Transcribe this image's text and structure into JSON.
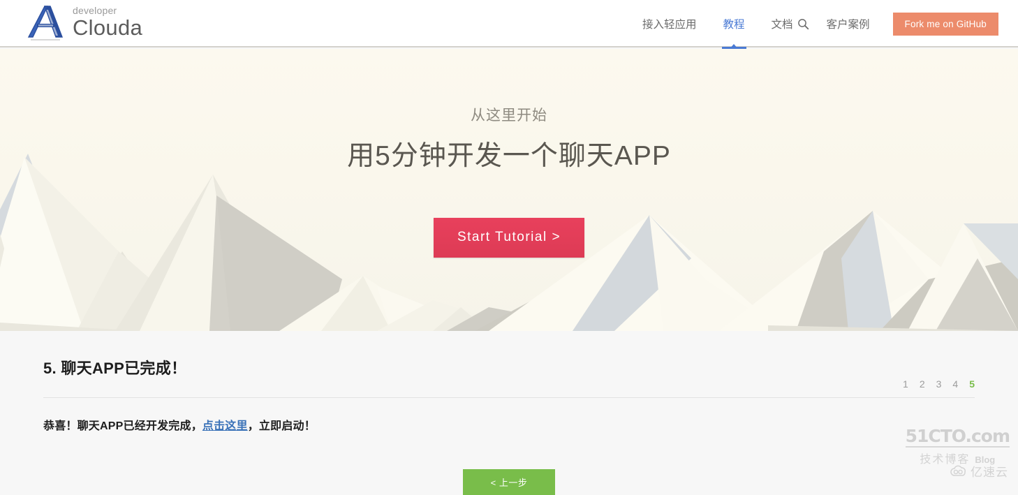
{
  "brand": {
    "sub_label": "developer",
    "name": "Clouda",
    "logo_icon": "clouda-a-logo-icon",
    "logo_color": "#2b4f9e"
  },
  "nav": {
    "items": [
      {
        "label": "接入轻应用",
        "active": false
      },
      {
        "label": "教程",
        "active": true
      },
      {
        "label": "文档",
        "active": false
      },
      {
        "label": "客户案例",
        "active": false
      }
    ],
    "search_icon": "search-icon",
    "github_button": "Fork me on GitHub",
    "active_color": "#4a7ad4",
    "github_color": "#ec8b6b"
  },
  "hero": {
    "subtitle": "从这里开始",
    "title": "用5分钟开发一个聊天APP",
    "cta_label": "Start Tutorial >",
    "cta_color": "#e03b57",
    "background": "low-poly-mountains",
    "sky_color": "#faf7ec"
  },
  "tutorial": {
    "section_title": "5. 聊天APP已完成！",
    "body": {
      "before_link": "恭喜！聊天APP已经开发完成，",
      "link_text": "点击这里",
      "after_link": "，立即启动！"
    },
    "pager": {
      "items": [
        "1",
        "2",
        "3",
        "4",
        "5"
      ],
      "current": "5",
      "active_color": "#79bd4a"
    },
    "prev_button": "< 上一步",
    "prev_button_color": "#79bd4a"
  },
  "watermarks": {
    "cto_main": "51CTO.com",
    "cto_cn": "技术博客",
    "cto_blog": "Blog",
    "yisuyun_text": "亿速云",
    "yisuyun_icon": "cloud-icon"
  }
}
